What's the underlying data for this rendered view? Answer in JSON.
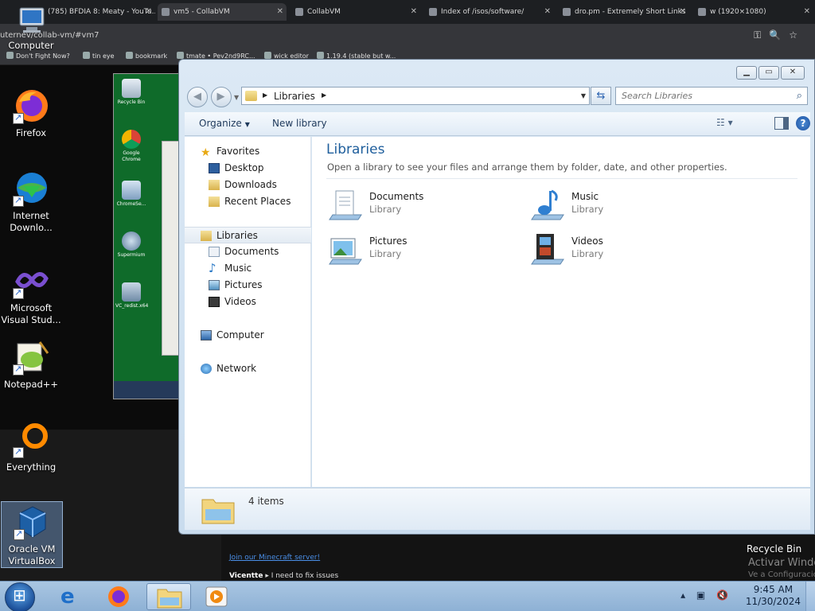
{
  "browser": {
    "tabs": [
      {
        "label": "(785) BFDIA 8: Meaty - YouTu..."
      },
      {
        "label": "vm5 - CollabVM"
      },
      {
        "label": "CollabVM"
      },
      {
        "label": "Index of /isos/software/"
      },
      {
        "label": "dro.pm - Extremely Short Links"
      },
      {
        "label": "w (1920×1080)"
      }
    ],
    "url": "uternev/collab-vm/#vm7",
    "bookmarks": [
      "Don't Fight Now?",
      "tin eye",
      "bookmark",
      "tmate • Pev2nd9RC...",
      "wick editor",
      "1.19.4 (stable but w..."
    ]
  },
  "desktop": {
    "icons": [
      {
        "label": "Computer"
      },
      {
        "label": "Firefox"
      },
      {
        "label": "Internet Downlo..."
      },
      {
        "label": "Microsoft Visual Stud..."
      },
      {
        "label": "Notepad++"
      },
      {
        "label": "Everything"
      },
      {
        "label": "Oracle VM VirtualBox"
      }
    ],
    "right_recycle_bin": "Recycle Bin",
    "activate_text": "Activar Windo",
    "activate_sub": "Ve a Configuració"
  },
  "inner_vm": {
    "icons": [
      {
        "label": "Recycle Bin"
      },
      {
        "label": "Google Chrome"
      },
      {
        "label": "ChromeSe..."
      },
      {
        "label": "Supermium"
      },
      {
        "label": "VC_redist.x64"
      }
    ]
  },
  "chat": {
    "link": "Join our Minecraft server!",
    "user": "Vicentte",
    "message": "I need to fix issues"
  },
  "explorer": {
    "address": "Libraries",
    "search_placeholder": "Search Libraries",
    "toolbar": {
      "organize": "Organize",
      "new_library": "New library"
    },
    "nav": {
      "favorites": "Favorites",
      "favorites_items": [
        "Desktop",
        "Downloads",
        "Recent Places"
      ],
      "libraries": "Libraries",
      "libraries_items": [
        "Documents",
        "Music",
        "Pictures",
        "Videos"
      ],
      "computer": "Computer",
      "network": "Network"
    },
    "content": {
      "title": "Libraries",
      "subtitle": "Open a library to see your files and arrange them by folder, date, and other properties.",
      "items": [
        {
          "name": "Documents",
          "type": "Library"
        },
        {
          "name": "Music",
          "type": "Library"
        },
        {
          "name": "Pictures",
          "type": "Library"
        },
        {
          "name": "Videos",
          "type": "Library"
        }
      ]
    },
    "details": {
      "count": "4 items"
    }
  },
  "taskbar": {
    "time": "9:45 AM",
    "date": "11/30/2024"
  }
}
